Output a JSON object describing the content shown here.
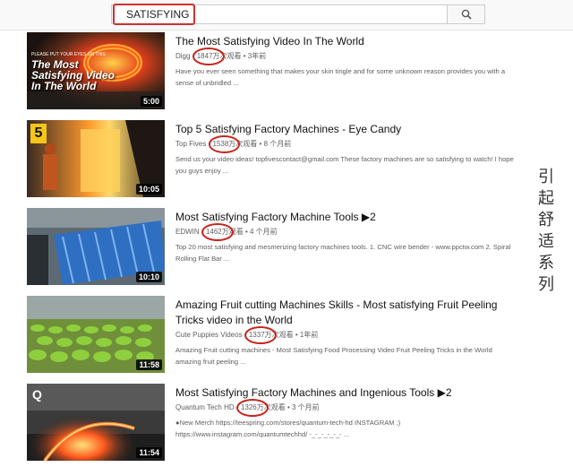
{
  "search": {
    "query": "SATISFYING"
  },
  "side_caption": [
    "引",
    "起",
    "舒",
    "适",
    "系",
    "列"
  ],
  "videos": [
    {
      "title": "The Most Satisfying Video In The World",
      "channel": "Digg",
      "views": "1847万",
      "views_suffix": "次观看",
      "age": "3年前",
      "duration": "5:00",
      "thumb_text": "The Most Satisfying Video In The World",
      "thumb_small": "PLEASE PUT YOUR EYES ON THIS",
      "desc": "Have you ever seen something that makes your skin tingle and for some unknown reason provides you with a sense of unbridled ..."
    },
    {
      "title": "Top 5 Satisfying Factory Machines - Eye Candy",
      "channel": "Top Fives",
      "views": "1538万",
      "views_suffix": "次观看",
      "age": "8 个月前",
      "duration": "10:05",
      "thumb_badge": "5",
      "desc": "Send us your video ideas! topfivescontact@gmail.com These factory machines are so satisfying to watch! I hope you guys enjoy ..."
    },
    {
      "title": "Most Satisfying Factory Machine Tools ▶2",
      "channel": "EDWIN",
      "views": "1462万",
      "views_suffix": "观看",
      "age": "4 个月前",
      "duration": "10:10",
      "desc": "Top 20 most satisfying and mesmerizing factory machines tools. 1. CNC wire bender - www.ppctw.com 2. Spiral Rolling Flat Bar ..."
    },
    {
      "title": "Amazing Fruit cutting Machines Skills - Most satisfying Fruit Peeling Tricks video in the World",
      "channel": "Cute Puppies Videos",
      "views": "1337万",
      "views_suffix": "次观看",
      "age": "1年前",
      "duration": "11:58",
      "desc": "Amazing Fruit cutting machines - Most Satisfying Food Processing Video Fruit Peeling Tricks in the World amazing fruit peeling ..."
    },
    {
      "title": "Most Satisfying Factory Machines and Ingenious Tools ▶2",
      "channel": "Quantum Tech HD",
      "views": "1326万",
      "views_suffix": "次观看",
      "age": "3 个月前",
      "duration": "11:54",
      "thumb_badge": "Q",
      "desc": "●New Merch https://teespring.com/stores/quantum-tech-hd INSTAGRAM ;) https://www.instagram.com/quantumtechhd/ -_-_-_-_-_- ..."
    }
  ]
}
